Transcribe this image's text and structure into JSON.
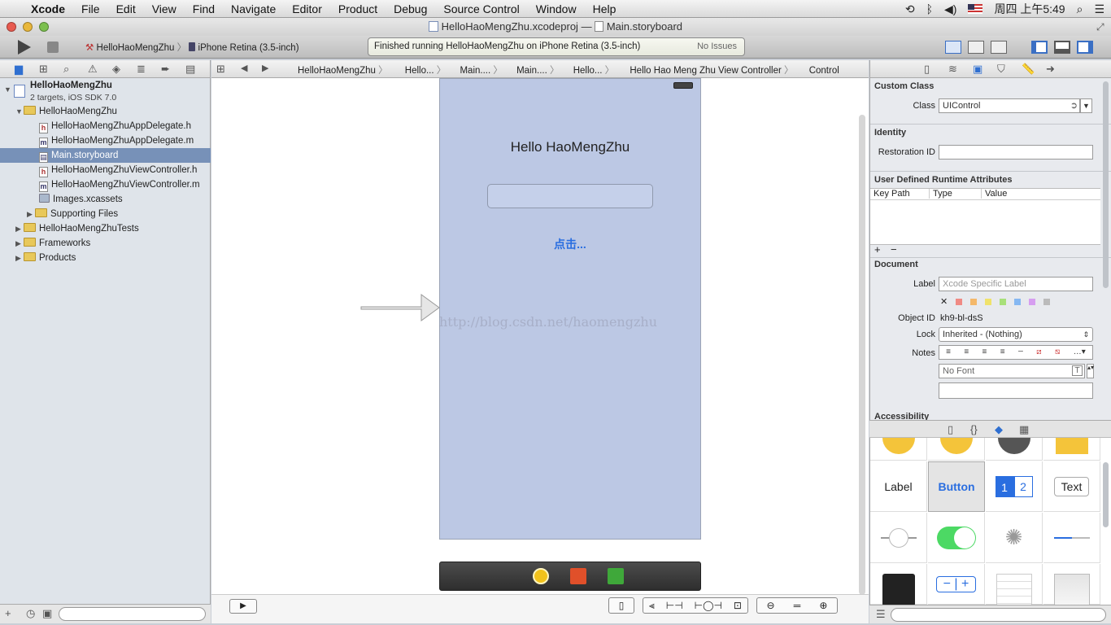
{
  "menubar": {
    "apple": "",
    "items": [
      "Xcode",
      "File",
      "Edit",
      "View",
      "Find",
      "Navigate",
      "Editor",
      "Product",
      "Debug",
      "Source Control",
      "Window",
      "Help"
    ],
    "clock": "周四 上午5:49"
  },
  "titlebar": {
    "project": "HelloHaoMengZhu.xcodeproj",
    "sep": "—",
    "file": "Main.storyboard"
  },
  "toolbar": {
    "scheme": "HelloHaoMengZhu",
    "device": "iPhone Retina (3.5-inch)",
    "status": "Finished running HelloHaoMengZhu on iPhone Retina (3.5-inch)",
    "issues": "No Issues"
  },
  "jumpbar": {
    "crumbs": [
      "HelloHaoMengZhu",
      "Hello...",
      "Main....",
      "Main....",
      "Hello...",
      "Hello Hao Meng Zhu View Controller",
      "Control"
    ]
  },
  "navigator": {
    "project_name": "HelloHaoMengZhu",
    "project_sub": "2 targets, iOS SDK 7.0",
    "items": [
      {
        "label": "HelloHaoMengZhu",
        "kind": "group"
      },
      {
        "label": "HelloHaoMengZhuAppDelegate.h",
        "kind": "h"
      },
      {
        "label": "HelloHaoMengZhuAppDelegate.m",
        "kind": "m"
      },
      {
        "label": "Main.storyboard",
        "kind": "sb"
      },
      {
        "label": "HelloHaoMengZhuViewController.h",
        "kind": "h"
      },
      {
        "label": "HelloHaoMengZhuViewController.m",
        "kind": "m"
      },
      {
        "label": "Images.xcassets",
        "kind": "assets"
      },
      {
        "label": "Supporting Files",
        "kind": "group"
      },
      {
        "label": "HelloHaoMengZhuTests",
        "kind": "group"
      },
      {
        "label": "Frameworks",
        "kind": "group"
      },
      {
        "label": "Products",
        "kind": "group"
      }
    ]
  },
  "scene": {
    "title_label": "Hello HaoMengZhu",
    "button_label": "点击...",
    "watermark": "http://blog.csdn.net/haomengzhu"
  },
  "inspector": {
    "custom_class_header": "Custom Class",
    "class_label": "Class",
    "class_value": "UIControl",
    "identity_header": "Identity",
    "restoration_label": "Restoration ID",
    "udra_header": "User Defined Runtime Attributes",
    "col_keypath": "Key Path",
    "col_type": "Type",
    "col_value": "Value",
    "document_header": "Document",
    "label_label": "Label",
    "label_placeholder": "Xcode Specific Label",
    "objectid_label": "Object ID",
    "objectid_value": "kh9-bl-dsS",
    "lock_label": "Lock",
    "lock_value": "Inherited - (Nothing)",
    "notes_label": "Notes",
    "font_placeholder": "No Font",
    "accessibility_header": "Accessibility"
  },
  "library": {
    "label_cell": "Label",
    "button_cell": "Button",
    "seg_1": "1",
    "seg_2": "2",
    "text_cell": "Text"
  },
  "colors": {
    "selection": "#7791b8",
    "scene_bg": "#bcc8e4",
    "ios_blue": "#2a6ee0",
    "switch_green": "#4cd964"
  }
}
